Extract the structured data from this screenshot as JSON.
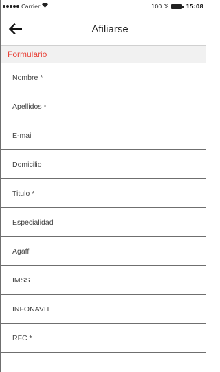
{
  "status_bar": {
    "carrier": "Carrier",
    "battery_percent": "100 %",
    "time": "15:08",
    "wifi_icon": "wifi-icon",
    "battery_icon": "battery-icon"
  },
  "nav": {
    "title": "Afiliarse",
    "back_icon": "arrow-left-icon"
  },
  "form": {
    "section_title": "Formulario",
    "accent_color": "#e8443a",
    "fields": [
      {
        "label": "Nombre *"
      },
      {
        "label": "Apellidos *"
      },
      {
        "label": "E-mail"
      },
      {
        "label": "Domicilio"
      },
      {
        "label": "Titulo *"
      },
      {
        "label": "Especialidad"
      },
      {
        "label": "Agaff"
      },
      {
        "label": "IMSS"
      },
      {
        "label": "INFONAVIT"
      },
      {
        "label": "RFC *"
      },
      {
        "label": ""
      }
    ]
  }
}
